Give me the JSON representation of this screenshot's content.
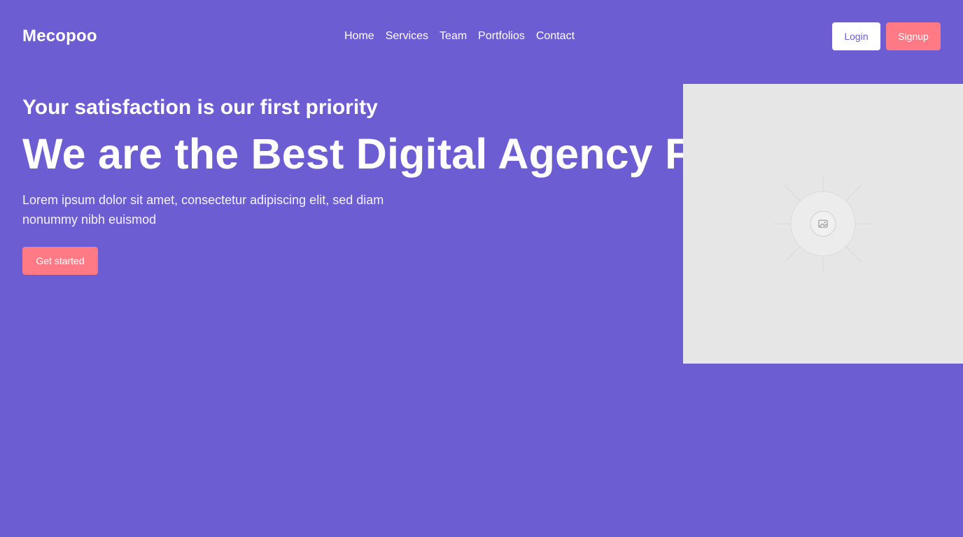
{
  "brand": {
    "name": "Mecopoo"
  },
  "nav": {
    "items": [
      {
        "label": "Home"
      },
      {
        "label": "Services"
      },
      {
        "label": "Team"
      },
      {
        "label": "Portfolios"
      },
      {
        "label": "Contact"
      }
    ]
  },
  "auth": {
    "login_label": "Login",
    "signup_label": "Signup"
  },
  "hero": {
    "eyebrow": "Your satisfaction is our first priority",
    "headline": "We are the Best Digital Agency For Your Business",
    "lead": "Lorem ipsum dolor sit amet, consectetur adipiscing elit, sed diam nonummy nibh euismod",
    "cta_label": "Get started",
    "media_icon": "image-placeholder-icon"
  },
  "colors": {
    "background": "#6c5dd3",
    "accent": "#ff7a85",
    "text": "#ffffff",
    "placeholder": "#e6e6e6"
  }
}
